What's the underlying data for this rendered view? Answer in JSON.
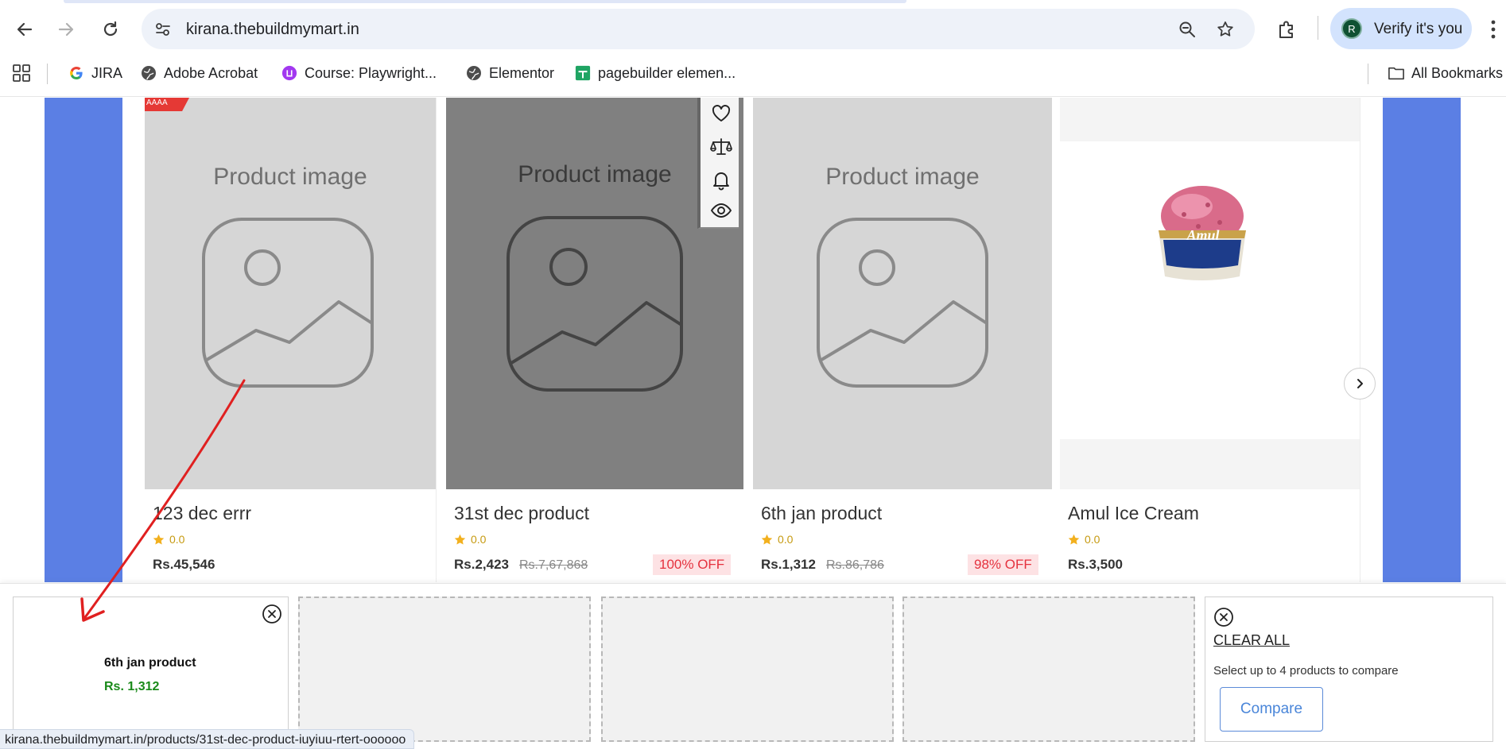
{
  "browser": {
    "url": "kirana.thebuildmymart.in",
    "verify_label": "Verify it's you",
    "avatar_letter": "R",
    "bookmarks": [
      "JIRA",
      "Adobe Acrobat",
      "Course: Playwright...",
      "Elementor",
      "pagebuilder elemen..."
    ],
    "all_bookmarks": "All Bookmarks"
  },
  "products": [
    {
      "name": "123 dec errr",
      "image_text": "Product image",
      "rating": "0.0",
      "price": "Rs.45,546",
      "mrp": "",
      "discount": "",
      "ribbon": "AAAA"
    },
    {
      "name": "31st dec product",
      "image_text": "Product image",
      "rating": "0.0",
      "price": "Rs.2,423",
      "mrp": "Rs.7,67,868",
      "discount": "100% OFF"
    },
    {
      "name": "6th jan product",
      "image_text": "Product image",
      "rating": "0.0",
      "price": "Rs.1,312",
      "mrp": "Rs.86,786",
      "discount": "98% OFF"
    },
    {
      "name": "Amul Ice Cream",
      "image_text": "",
      "rating": "0.0",
      "price": "Rs.3,500",
      "mrp": "",
      "discount": "",
      "brand_text": "Amul"
    }
  ],
  "compare": {
    "selected": {
      "name": "6th jan product",
      "price": "Rs. 1,312"
    },
    "clear_all": "CLEAR ALL",
    "hint": "Select up to 4 products to compare",
    "button": "Compare"
  },
  "status_url": "kirana.thebuildmymart.in/products/31st-dec-product-iuyiuu-rtert-oooooo",
  "colors": {
    "side_banner": "#5b7fe4",
    "discount_text": "#e5323e",
    "discount_bg": "#fde2e4",
    "compare_price": "#1a8a1a",
    "annotation_arrow": "#e02020"
  }
}
